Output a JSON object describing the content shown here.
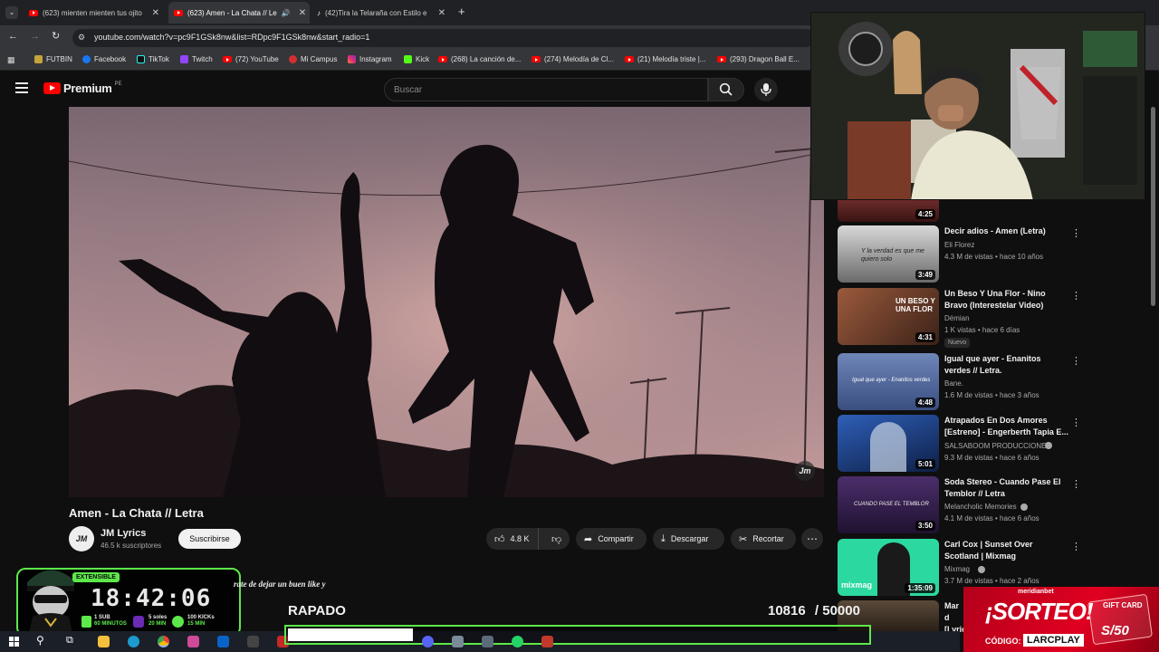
{
  "browser": {
    "tabs": [
      {
        "title": "(623) mienten mienten tus ojito"
      },
      {
        "title": "(623) Amen - La Chata // Le"
      },
      {
        "title": "(42)Tira la Telaraña con Estilo e"
      }
    ],
    "new_tab": "+",
    "url": "youtube.com/watch?v=pc9F1GSk8nw&list=RDpc9F1GSk8nw&start_radio=1",
    "bookmarks": [
      {
        "label": "FUTBIN"
      },
      {
        "label": "Facebook"
      },
      {
        "label": "TikTok"
      },
      {
        "label": "Twitch"
      },
      {
        "label": "(72) YouTube"
      },
      {
        "label": "Mi Campus"
      },
      {
        "label": "Instagram"
      },
      {
        "label": "Kick"
      },
      {
        "label": "(268) La canción de..."
      },
      {
        "label": "(274) Melodía de Cl..."
      },
      {
        "label": "(21) Melodía triste |..."
      },
      {
        "label": "(293) Dragon Ball E..."
      }
    ]
  },
  "youtube": {
    "logo": "Premium",
    "logo_suffix": "PE",
    "search_placeholder": "Buscar",
    "video": {
      "title": "Amen - La Chata // Letra",
      "watermark": "Jm"
    },
    "channel": {
      "avatar": "JM",
      "name": "JM Lyrics",
      "subscribers": "46.5 k suscriptores",
      "subscribe_label": "Suscribirse"
    },
    "actions": {
      "likes": "4.8 K",
      "share": "Compartir",
      "download": "Descargar",
      "clip": "Recortar",
      "more": "⋯"
    },
    "recommendations": [
      {
        "title": "",
        "channel": "",
        "meta": "",
        "duration": "4:25"
      },
      {
        "title": "Decir adios - Amen (Letra)",
        "channel": "Eli Florez",
        "meta": "4.3 M de vistas • hace 10 años",
        "duration": "3:49"
      },
      {
        "title": "Un Beso Y Una Flor - Nino Bravo (Interestelar Video)",
        "channel": "Démian",
        "meta": "1 K vistas • hace 6 días",
        "duration": "4:31",
        "badge": "Nuevo"
      },
      {
        "title": "Igual que ayer - Enanitos verdes // Letra.",
        "channel": "Bane.",
        "meta": "1.6 M de vistas • hace 3 años",
        "duration": "4:48"
      },
      {
        "title": "Atrapados En Dos Amores [Estreno] - Engerberth Tapia E...",
        "channel": "SALSABOOM PRODUCCIONES",
        "meta": "9.3 M de vistas • hace 6 años",
        "duration": "5:01"
      },
      {
        "title": "Soda Stereo - Cuando Pase El Temblor // Letra",
        "channel": "Melancholic Memories",
        "meta": "4.1 M de vistas • hace 6 años",
        "duration": "3:50"
      },
      {
        "title": "Carl Cox | Sunset Over Scotland | Mixmag",
        "channel": "Mixmag",
        "meta": "3.7 M de vistas • hace 2 años",
        "duration": "1:35:09"
      },
      {
        "title": "Mar d [Lyric",
        "channel": "",
        "meta": "",
        "duration": ""
      }
    ],
    "thumb_texts": {
      "rec1": "Y la verdad es que me quiero solo",
      "rec3": "Igual que ayer - Enanitos verdes",
      "rec5": "CUANDO PASE EL TEMBLOR",
      "rec6": "mixmag",
      "rec3_title_overlay": "UN BESO Y UNA FLOR"
    }
  },
  "overlay": {
    "timer_badge": "EXTENSIBLE",
    "timer": "18:42:06",
    "perks": [
      {
        "top": "1 SUB",
        "bottom": "60 MINUTOS"
      },
      {
        "top": "5 soles",
        "bottom": "20 MIN"
      },
      {
        "top": "100 KICKs",
        "bottom": "15 MIN"
      }
    ],
    "message": "rate de dejar un buen like y",
    "goal_label": "RAPADO",
    "goal_current": "10816",
    "goal_target": "/ 50000",
    "goal_fraction": 0.216,
    "colors": {
      "accent": "#5de84a"
    }
  },
  "sponsor": {
    "brand": "meridianbet",
    "headline": "¡SORTEO!",
    "code_label": "CÓDIGO:",
    "code": "LARCPLAY",
    "gift_label": "GIFT CARD",
    "gift_amount": "S/50"
  }
}
